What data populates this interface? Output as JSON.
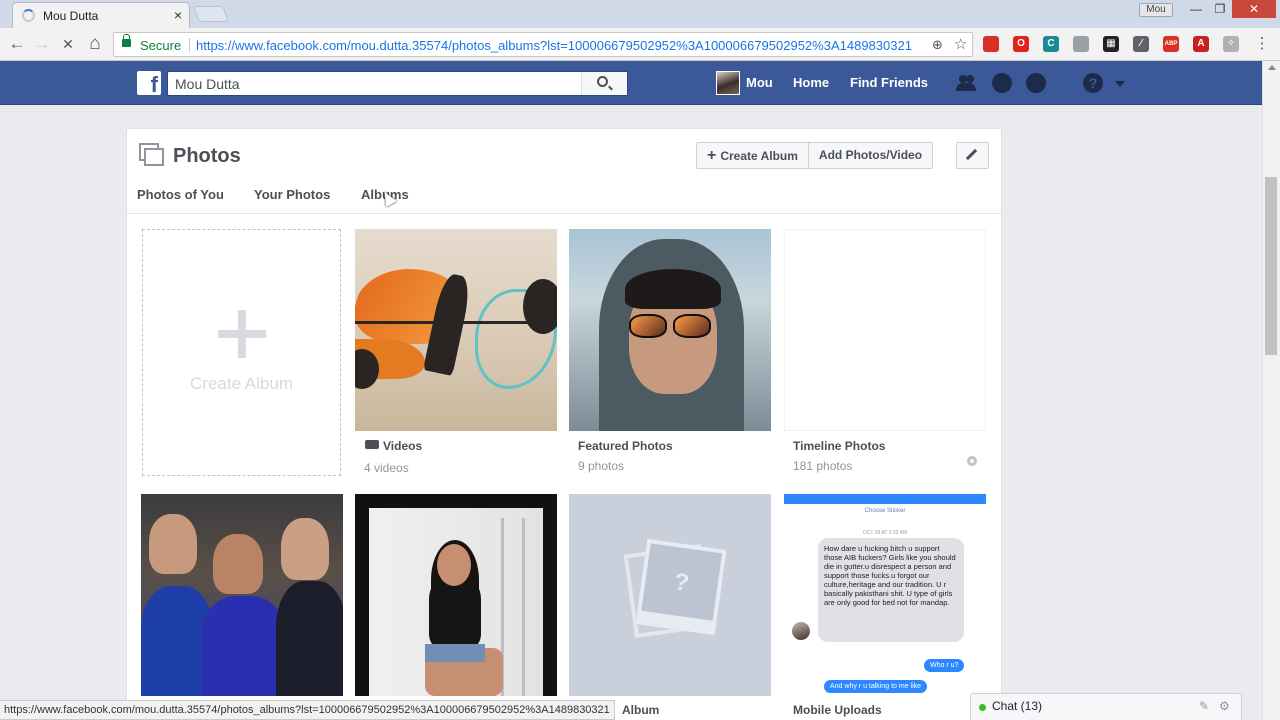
{
  "browser": {
    "tab_title": "Mou Dutta",
    "tab_close": "×",
    "profile_name": "Mou",
    "secure_label": "Secure",
    "url_host": "https://www.facebook.com",
    "url_rest": "/mou.dutta.35574/photos_albums?lst=100006679502952%3A100006679502952%3A1489830321",
    "back_glyph": "←",
    "forward_glyph": "→",
    "stop_glyph": "✕",
    "home_glyph": "⌂",
    "menu_glyph": "⋮",
    "star_glyph": "☆",
    "zoom_glyph": "⊕"
  },
  "extensions": [
    {
      "name": "red-square-extension-icon",
      "color": "#d93025",
      "glyph": ""
    },
    {
      "name": "opera-extension-icon",
      "color": "#e0241b",
      "glyph": "O"
    },
    {
      "name": "teal-extension-icon",
      "color": "#1a8a94",
      "glyph": "C"
    },
    {
      "name": "gray-extension-icon",
      "color": "#9aa0a6",
      "glyph": ""
    },
    {
      "name": "grid-extension-icon",
      "color": "#222222",
      "glyph": "▦"
    },
    {
      "name": "slash-extension-icon",
      "color": "#5f6368",
      "glyph": "⁄"
    },
    {
      "name": "adblock-extension-icon",
      "color": "#d93025",
      "glyph": "ABP"
    },
    {
      "name": "pdf-extension-icon",
      "color": "#c5221f",
      "glyph": "A"
    },
    {
      "name": "pocket-extension-icon",
      "color": "#b0b0b0",
      "glyph": "✧"
    }
  ],
  "facebook": {
    "brand_color": "#3b5998",
    "logo_letter": "f",
    "search_value": "Mou Dutta",
    "profile_label": "Mou",
    "home_label": "Home",
    "find_friends_label": "Find Friends",
    "help_glyph": "?"
  },
  "photos": {
    "title": "Photos",
    "create_album_btn": "Create Album",
    "add_photos_btn": "Add Photos/Video",
    "tabs": [
      "Photos of You",
      "Your Photos",
      "Albums"
    ],
    "create_tile_label": "Create Album",
    "albums": [
      {
        "name": "Videos",
        "count": "4 videos"
      },
      {
        "name": "Featured Photos",
        "count": "9 photos"
      },
      {
        "name": "Timeline Photos",
        "count": "181 photos"
      }
    ],
    "row2_labels": [
      "Album",
      "Mobile Uploads"
    ]
  },
  "chat_screenshot": {
    "caption": "Choose Sticker",
    "date": "OCT 28 AT 3:10 AM",
    "message": "How dare u fucking bitch u support those AIB fuckers? Girls like you should die in gutter.u disrespect a person and support those fucks.u forgot our culture,heritage and our tradition. U r basically pakisthani shit. U type of girls are only good for bed not for mandap.",
    "reply1": "Who r u?",
    "reply2": "And why r u talking to me like"
  },
  "statusbar": {
    "url": "https://www.facebook.com/mou.dutta.35574/photos_albums?lst=100006679502952%3A100006679502952%3A1489830321"
  },
  "chat": {
    "label": "Chat (13)"
  }
}
